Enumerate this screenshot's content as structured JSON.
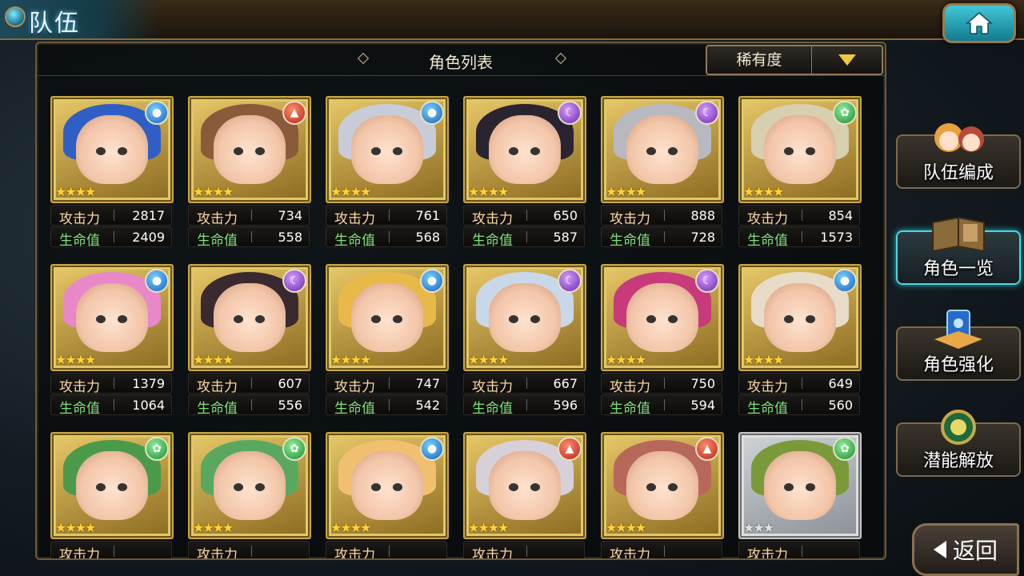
{
  "header": {
    "title": "队伍"
  },
  "list": {
    "title": "角色列表",
    "sort_label": "稀有度"
  },
  "labels": {
    "attack": "攻击力",
    "hp": "生命值"
  },
  "side_menu": [
    {
      "label": "队伍编成",
      "icon": "party-portraits-icon"
    },
    {
      "label": "角色一览",
      "icon": "character-book-icon",
      "active": true
    },
    {
      "label": "角色强化",
      "icon": "enhance-crystal-icon"
    },
    {
      "label": "潜能解放",
      "icon": "potential-orb-icon"
    }
  ],
  "back": {
    "label": "返回"
  },
  "colors": {
    "water": "#1663b8",
    "fire": "#b8261a",
    "dark": "#6a2aa8",
    "wind": "#1d8a32",
    "frame_gold": "#c9a744"
  },
  "characters": [
    {
      "element": "water",
      "stars": 4,
      "attack": "2817",
      "hp": "2409",
      "hair": "#2f5fc4"
    },
    {
      "element": "fire",
      "stars": 4,
      "attack": "734",
      "hp": "558",
      "hair": "#8a5a3a"
    },
    {
      "element": "water",
      "stars": 4,
      "attack": "761",
      "hp": "568",
      "hair": "#c8ccd8"
    },
    {
      "element": "dark",
      "stars": 4,
      "attack": "650",
      "hp": "587",
      "hair": "#2a2430"
    },
    {
      "element": "dark",
      "stars": 4,
      "attack": "888",
      "hp": "728",
      "hair": "#b8b8c0"
    },
    {
      "element": "wind",
      "stars": 4,
      "attack": "854",
      "hp": "1573",
      "hair": "#d8cfb0"
    },
    {
      "element": "water",
      "stars": 4,
      "attack": "1379",
      "hp": "1064",
      "hair": "#e888c8"
    },
    {
      "element": "dark",
      "stars": 4,
      "attack": "607",
      "hp": "556",
      "hair": "#3a2a30"
    },
    {
      "element": "water",
      "stars": 4,
      "attack": "747",
      "hp": "542",
      "hair": "#e8b848"
    },
    {
      "element": "dark",
      "stars": 4,
      "attack": "667",
      "hp": "596",
      "hair": "#c8d8e8"
    },
    {
      "element": "dark",
      "stars": 4,
      "attack": "750",
      "hp": "594",
      "hair": "#c83a7a"
    },
    {
      "element": "water",
      "stars": 4,
      "attack": "649",
      "hp": "560",
      "hair": "#e8dcc8"
    },
    {
      "element": "wind",
      "stars": 4,
      "attack": "",
      "hp": "",
      "hair": "#4a9a4a"
    },
    {
      "element": "wind",
      "stars": 4,
      "attack": "",
      "hp": "",
      "hair": "#5aa860"
    },
    {
      "element": "water",
      "stars": 4,
      "attack": "",
      "hp": "",
      "hair": "#f0c070"
    },
    {
      "element": "fire",
      "stars": 4,
      "attack": "",
      "hp": "",
      "hair": "#d8d0d8"
    },
    {
      "element": "fire",
      "stars": 4,
      "attack": "",
      "hp": "",
      "hair": "#b8685a"
    },
    {
      "element": "wind",
      "stars": 3,
      "attack": "",
      "hp": "",
      "hair": "#7a9a3a",
      "frame": "silver"
    }
  ]
}
